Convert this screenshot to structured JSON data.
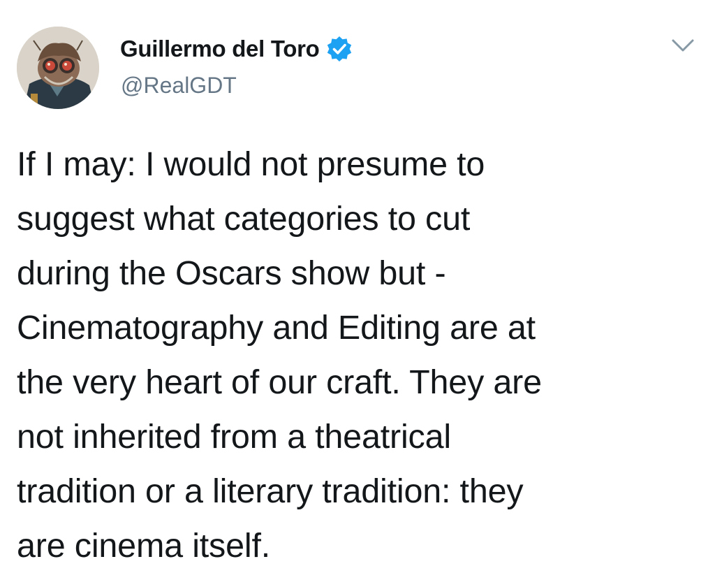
{
  "tweet": {
    "author": {
      "display_name": "Guillermo del Toro",
      "handle": "@RealGDT",
      "verified": true,
      "avatar_icon": "character-avatar-icon"
    },
    "text": "If I may: I would not presume to\nsuggest what categories to cut\nduring the Oscars show but -\nCinematography and Editing are at\nthe very heart of our craft. They are\nnot inherited from a theatrical\ntradition or a literary tradition: they\nare cinema itself.",
    "menu_icon": "chevron-down-icon"
  },
  "colors": {
    "verified_blue": "#1da1f2",
    "text_primary": "#14171a",
    "text_secondary": "#657786"
  }
}
